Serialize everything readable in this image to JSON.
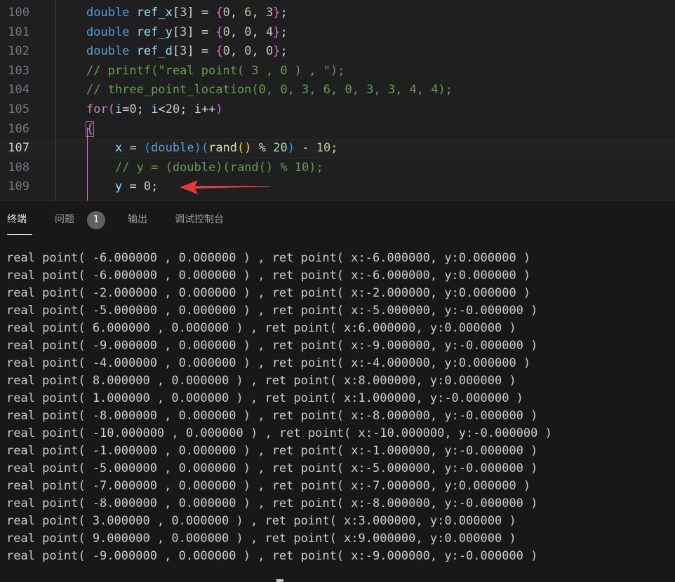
{
  "editor": {
    "lines": [
      {
        "num": "100",
        "tokens": [
          [
            "kw",
            "double"
          ],
          [
            "plain",
            " "
          ],
          [
            "var",
            "ref_x"
          ],
          [
            "plain",
            "["
          ],
          [
            "num",
            "3"
          ],
          [
            "plain",
            "] = "
          ],
          [
            "br1",
            "{"
          ],
          [
            "num",
            "0"
          ],
          [
            "plain",
            ", "
          ],
          [
            "num",
            "6"
          ],
          [
            "plain",
            ", "
          ],
          [
            "num",
            "3"
          ],
          [
            "br1",
            "}"
          ],
          [
            "plain",
            ";"
          ]
        ]
      },
      {
        "num": "101",
        "tokens": [
          [
            "kw",
            "double"
          ],
          [
            "plain",
            " "
          ],
          [
            "var",
            "ref_y"
          ],
          [
            "plain",
            "["
          ],
          [
            "num",
            "3"
          ],
          [
            "plain",
            "] = "
          ],
          [
            "br1",
            "{"
          ],
          [
            "num",
            "0"
          ],
          [
            "plain",
            ", "
          ],
          [
            "num",
            "0"
          ],
          [
            "plain",
            ", "
          ],
          [
            "num",
            "4"
          ],
          [
            "br1",
            "}"
          ],
          [
            "plain",
            ";"
          ]
        ]
      },
      {
        "num": "102",
        "tokens": [
          [
            "kw",
            "double"
          ],
          [
            "plain",
            " "
          ],
          [
            "var",
            "ref_d"
          ],
          [
            "plain",
            "["
          ],
          [
            "num",
            "3"
          ],
          [
            "plain",
            "] = "
          ],
          [
            "br1",
            "{"
          ],
          [
            "num",
            "0"
          ],
          [
            "plain",
            ", "
          ],
          [
            "num",
            "0"
          ],
          [
            "plain",
            ", "
          ],
          [
            "num",
            "0"
          ],
          [
            "br1",
            "}"
          ],
          [
            "plain",
            ";"
          ]
        ]
      },
      {
        "num": "103",
        "tokens": [
          [
            "cm",
            "// printf(\"real point( 3 , 0 ) , \");"
          ]
        ]
      },
      {
        "num": "104",
        "tokens": [
          [
            "cm",
            "// three_point_location(0, 0, 3, 6, 0, 3, 3, 4, 4);"
          ]
        ]
      },
      {
        "num": "105",
        "tokens": [
          [
            "ctl",
            "for"
          ],
          [
            "br1",
            "("
          ],
          [
            "var",
            "i"
          ],
          [
            "plain",
            "="
          ],
          [
            "num",
            "0"
          ],
          [
            "plain",
            "; "
          ],
          [
            "var",
            "i"
          ],
          [
            "plain",
            "<"
          ],
          [
            "num",
            "20"
          ],
          [
            "plain",
            "; "
          ],
          [
            "var",
            "i"
          ],
          [
            "plain",
            "++"
          ],
          [
            "br1",
            ")"
          ]
        ]
      },
      {
        "num": "106",
        "tokens": [
          [
            "br1",
            "{"
          ]
        ]
      },
      {
        "num": "107",
        "tokens": [
          [
            "plain",
            "    "
          ],
          [
            "var",
            "x"
          ],
          [
            "plain",
            " = "
          ],
          [
            "br3",
            "("
          ],
          [
            "kw",
            "double"
          ],
          [
            "br3",
            ")"
          ],
          [
            "br3",
            "("
          ],
          [
            "fn",
            "rand"
          ],
          [
            "br2",
            "()"
          ],
          [
            "plain",
            " % "
          ],
          [
            "num",
            "20"
          ],
          [
            "br3",
            ")"
          ],
          [
            "plain",
            " - "
          ],
          [
            "num",
            "10"
          ],
          [
            "plain",
            ";"
          ]
        ]
      },
      {
        "num": "108",
        "tokens": [
          [
            "plain",
            "    "
          ],
          [
            "cm",
            "// y = (double)(rand() % 10);"
          ]
        ]
      },
      {
        "num": "109",
        "tokens": [
          [
            "plain",
            "    "
          ],
          [
            "var",
            "y"
          ],
          [
            "plain",
            " = "
          ],
          [
            "num",
            "0"
          ],
          [
            "plain",
            ";"
          ]
        ]
      }
    ],
    "current_line": "107"
  },
  "panel": {
    "tabs": [
      {
        "label": "终端",
        "active": true
      },
      {
        "label": "问题",
        "active": false
      },
      {
        "label": "输出",
        "active": false
      },
      {
        "label": "调试控制台",
        "active": false
      }
    ],
    "problems_count": "1",
    "terminal_lines": [
      "real point( -6.000000 , 0.000000 ) , ret point( x:-6.000000, y:0.000000 )",
      "real point( -6.000000 , 0.000000 ) , ret point( x:-6.000000, y:0.000000 )",
      "real point( -2.000000 , 0.000000 ) , ret point( x:-2.000000, y:0.000000 )",
      "real point( -5.000000 , 0.000000 ) , ret point( x:-5.000000, y:-0.000000 )",
      "real point( 6.000000 , 0.000000 ) , ret point( x:6.000000, y:0.000000 )",
      "real point( -9.000000 , 0.000000 ) , ret point( x:-9.000000, y:-0.000000 )",
      "real point( -4.000000 , 0.000000 ) , ret point( x:-4.000000, y:0.000000 )",
      "real point( 8.000000 , 0.000000 ) , ret point( x:8.000000, y:0.000000 )",
      "real point( 1.000000 , 0.000000 ) , ret point( x:1.000000, y:-0.000000 )",
      "real point( -8.000000 , 0.000000 ) , ret point( x:-8.000000, y:-0.000000 )",
      "real point( -10.000000 , 0.000000 ) , ret point( x:-10.000000, y:-0.000000 )",
      "real point( -1.000000 , 0.000000 ) , ret point( x:-1.000000, y:-0.000000 )",
      "real point( -5.000000 , 0.000000 ) , ret point( x:-5.000000, y:-0.000000 )",
      "real point( -7.000000 , 0.000000 ) , ret point( x:-7.000000, y:0.000000 )",
      "real point( -8.000000 , 0.000000 ) , ret point( x:-8.000000, y:-0.000000 )",
      "real point( 3.000000 , 0.000000 ) , ret point( x:3.000000, y:0.000000 )",
      "real point( 9.000000 , 0.000000 ) , ret point( x:9.000000, y:0.000000 )",
      "real point( -9.000000 , 0.000000 ) , ret point( x:-9.000000, y:-0.000000 )"
    ]
  },
  "colors": {
    "editor_bg": "#1f1f1f",
    "panel_bg": "#181818",
    "keyword": "#569cd6",
    "control": "#c586c0",
    "variable": "#9cdcfe",
    "number": "#b5cea8",
    "function": "#dcdcaa",
    "comment": "#6a9955",
    "arrow": "#e53935"
  },
  "icons": {
    "annotation": "red-arrow-icon"
  }
}
